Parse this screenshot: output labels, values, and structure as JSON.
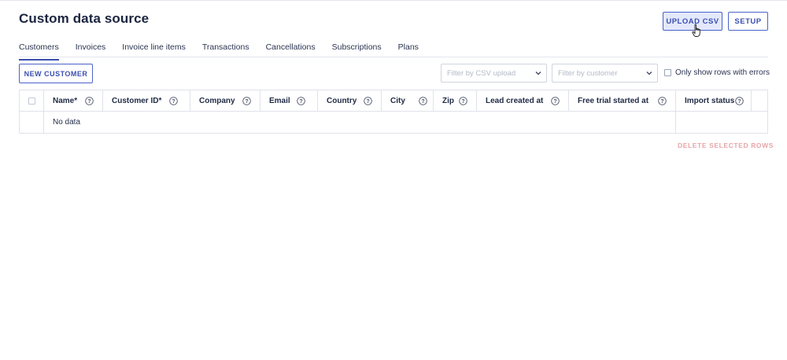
{
  "page": {
    "title": "Custom data source"
  },
  "header_actions": {
    "upload_csv": "UPLOAD CSV",
    "setup": "SETUP"
  },
  "tabs": [
    {
      "label": "Customers",
      "active": true
    },
    {
      "label": "Invoices"
    },
    {
      "label": "Invoice line items"
    },
    {
      "label": "Transactions"
    },
    {
      "label": "Cancellations"
    },
    {
      "label": "Subscriptions"
    },
    {
      "label": "Plans"
    }
  ],
  "toolbar": {
    "new_customer": "NEW CUSTOMER",
    "filter_csv_placeholder": "Filter by CSV upload",
    "filter_customer_placeholder": "Filter by customer",
    "errors_only_label": "Only show rows with errors"
  },
  "table": {
    "columns": [
      {
        "label": "Name*"
      },
      {
        "label": "Customer ID*"
      },
      {
        "label": "Company"
      },
      {
        "label": "Email"
      },
      {
        "label": "Country"
      },
      {
        "label": "City"
      },
      {
        "label": "Zip"
      },
      {
        "label": "Lead created at"
      },
      {
        "label": "Free trial started at"
      },
      {
        "label": "Import status"
      }
    ],
    "empty_text": "No data"
  },
  "footer": {
    "delete_selected": "DELETE SELECTED ROWS"
  },
  "colors": {
    "accent": "#3a4fb0",
    "danger_disabled": "#e8a5a8",
    "border": "#dfe2ea"
  }
}
